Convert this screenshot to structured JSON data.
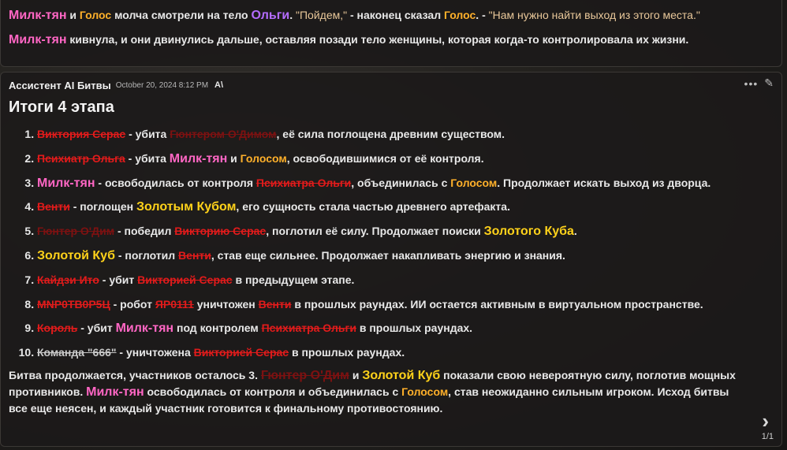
{
  "top_message": {
    "line1": {
      "milk": "Милк-тян",
      "and": " и ",
      "voice": "Голос",
      "silently": " молча смотрели на тело ",
      "olga": "Ольги",
      "dot": ". ",
      "quote1": "\"Пойдем,\"",
      "said": " - наконец сказал ",
      "voice2": "Голос",
      "dash": ". - ",
      "quote2": "\"Нам нужно найти выход из этого места.\""
    },
    "line2": {
      "milk": "Милк-тян",
      "text": " кивнула, и они двинулись дальше, оставляя позади тело женщины, которая когда-то контролировала их жизни."
    }
  },
  "message": {
    "author": "Ассистент AI Битвы",
    "timestamp": "October 20, 2024 8:12 PM",
    "badge": "A\\",
    "title": "Итоги 4 этапа",
    "items": {
      "i1": {
        "a": "Виктория Серас",
        "b": " - убита ",
        "c": "Гюнтером О'Димом",
        "d": ", её сила поглощена древним существом."
      },
      "i2": {
        "a": "Психиатр Ольга",
        "b": " - убита ",
        "c": "Милк-тян",
        "d": " и ",
        "e": "Голосом",
        "f": ", освободившимися от её контроля."
      },
      "i3": {
        "a": "Милк-тян",
        "b": " - освободилась от контроля ",
        "c": "Психиатра Ольги",
        "d": ", объединилась с ",
        "e": "Голосом",
        "f": ". Продолжает искать выход из дворца."
      },
      "i4": {
        "a": "Венти",
        "b": " - поглощен ",
        "c": "Золотым Кубом",
        "d": ", его сущность стала частью древнего артефакта."
      },
      "i5": {
        "a": "Гюнтер О'Дим",
        "b": " - победил ",
        "c": "Викторию Серас",
        "d": ", поглотил её силу. Продолжает поиски ",
        "e": "Золотого Куба",
        "f": "."
      },
      "i6": {
        "a": "Золотой Куб",
        "b": " - поглотил ",
        "c": "Венти",
        "d": ", став еще сильнее. Продолжает накапливать энергию и знания."
      },
      "i7": {
        "a": "Кайдзи Ито",
        "b": " - убит ",
        "c": "Викторией Серас",
        "d": " в предыдущем этапе."
      },
      "i8": {
        "a": "MNP0TB0P5Ц",
        "b": " - робот ",
        "c": "ЯР0111",
        "d": " уничтожен ",
        "e": "Венти",
        "f": " в прошлых раундах. ИИ остается активным в виртуальном пространстве."
      },
      "i9": {
        "a": "Король",
        "b": " - убит ",
        "c": "Милк-тян",
        "d": " под контролем ",
        "e": "Психиатра Ольги",
        "f": " в прошлых раундах."
      },
      "i10": {
        "a": "Команда \"666\"",
        "b": " - уничтожена ",
        "c": "Викторией Серас",
        "d": " в прошлых раундах."
      }
    },
    "summary": {
      "s1": "Битва продолжается, участников осталось 3. ",
      "gunter": "Гюнтер О'Дим",
      "and": " и ",
      "cube": "Золотой Куб",
      "s2": " показали свою невероятную силу, поглотив мощных противников. ",
      "milk": "Милк-тян",
      "s3": " освободилась от контроля и объединилась с ",
      "voice": "Голосом",
      "s4": ", став неожиданно сильным игроком. Исход битвы все еще неясен, и каждый участник готовится к финальному противостоянию."
    },
    "pager": "1/1",
    "icons": {
      "more": "more-horizontal-icon",
      "edit": "pencil-icon",
      "next": "chevron-right-icon"
    }
  }
}
